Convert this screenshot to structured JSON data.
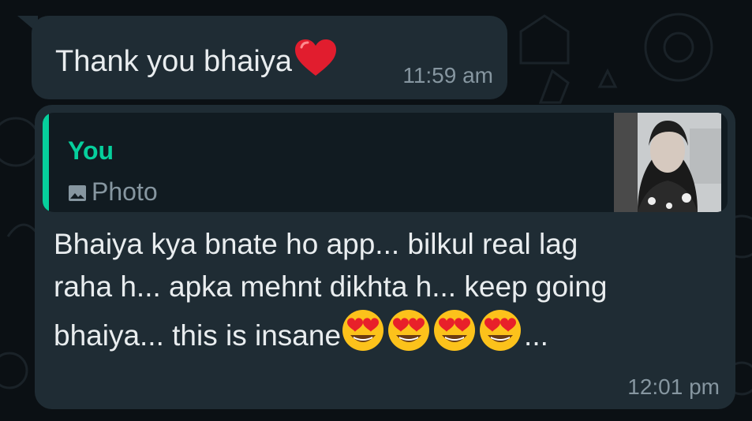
{
  "colors": {
    "bubble": "#1f2c34",
    "background": "#0b1014",
    "text": "#e9edef",
    "meta": "#8696a0",
    "accent": "#06cf9c"
  },
  "messages": [
    {
      "text": "Thank you bhaiya",
      "emoji_icon": "red-heart-icon",
      "time": "11:59 am"
    },
    {
      "quote": {
        "author": "You",
        "type_icon": "photo-icon",
        "type_label": "Photo",
        "thumbnail": "quoted-photo-thumbnail"
      },
      "lines": [
        "Bhaiya kya bnate ho app... bilkul real lag",
        "raha h... apka mehnt dikhta h... keep going",
        "bhaiya... this is insane"
      ],
      "emoji_icons": [
        "heart-eyes-emoji-icon",
        "heart-eyes-emoji-icon",
        "heart-eyes-emoji-icon",
        "heart-eyes-emoji-icon"
      ],
      "suffix": "...",
      "time": "12:01 pm"
    }
  ]
}
